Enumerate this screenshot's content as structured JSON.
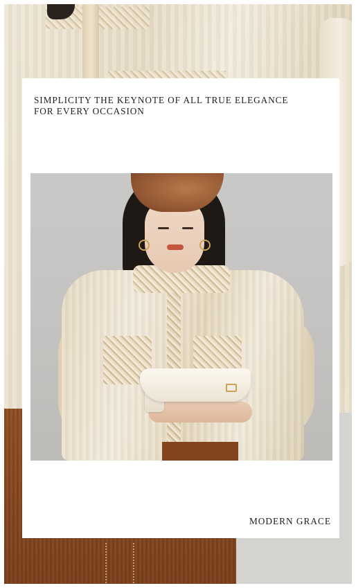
{
  "card": {
    "tagline_lines": [
      "SIMPLICITY THE KEYNOTE OF ALL TRUE ELEGANCE",
      "FOR EVERY OCCASION"
    ],
    "footer_label": "MODERN GRACE"
  },
  "colors": {
    "card_background": "#ffffff",
    "text": "#1e1e1e",
    "skirt_brown": "#8f4d22",
    "blouse_cream": "#efe7d6",
    "wall_gray": "#c9c9c8"
  },
  "images": {
    "background": "photo-model-cream-blouse-brown-skirt",
    "inner": "photo-model-beret-holding-cream-heel-shoe"
  }
}
